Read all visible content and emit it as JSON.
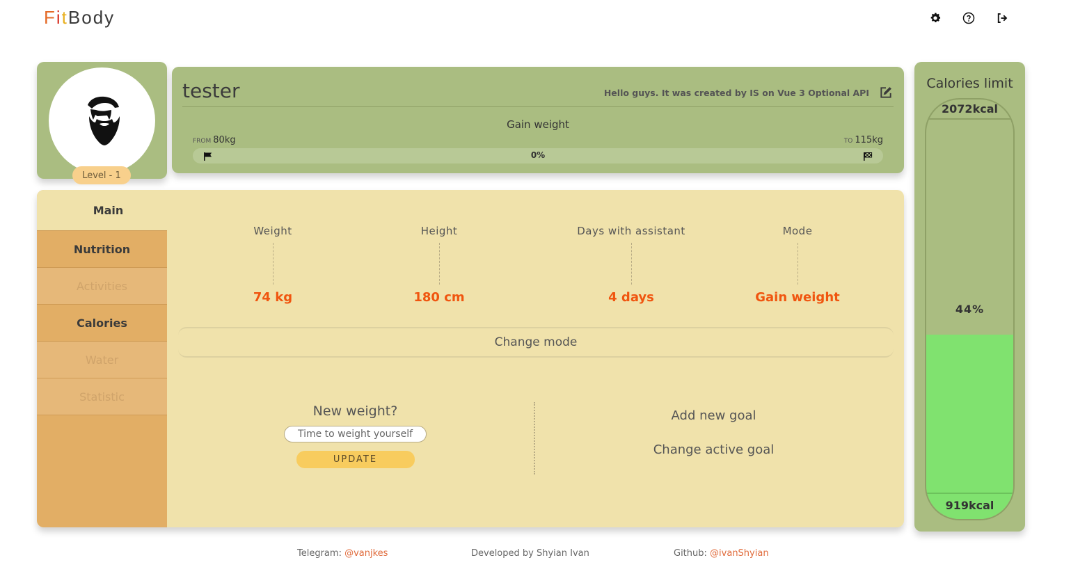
{
  "header": {
    "logo": {
      "part1": "F",
      "part2": "i",
      "part3": "t",
      "part4": "Body"
    },
    "icons": [
      "gear-icon",
      "help-icon",
      "logout-icon"
    ]
  },
  "avatar": {
    "level_label": "Level - 1"
  },
  "profile": {
    "username": "tester",
    "bio": "Hello guys. It was created by IS on Vue 3 Optional API",
    "goal_name": "Gain weight",
    "from_label": "FROM",
    "from_value": "80kg",
    "to_label": "TO",
    "to_value": "115kg",
    "progress_text": "0%",
    "progress_fraction": 0
  },
  "sidebar": {
    "items": [
      {
        "label": "Main",
        "state": "active"
      },
      {
        "label": "Nutrition",
        "state": "enabled"
      },
      {
        "label": "Activities",
        "state": "disabled"
      },
      {
        "label": "Calories",
        "state": "enabled"
      },
      {
        "label": "Water",
        "state": "disabled"
      },
      {
        "label": "Statistic",
        "state": "disabled"
      }
    ]
  },
  "stats": [
    {
      "label": "Weight",
      "value": "74 kg"
    },
    {
      "label": "Height",
      "value": "180 cm"
    },
    {
      "label": "Days with assistant",
      "value": "4 days"
    },
    {
      "label": "Mode",
      "value": "Gain weight"
    }
  ],
  "change_mode_label": "Change mode",
  "new_weight": {
    "title": "New weight?",
    "placeholder": "Time to weight yourself",
    "button_label": "UPDATE"
  },
  "goals": {
    "add_label": "Add new goal",
    "change_label": "Change active goal"
  },
  "calories": {
    "title": "Calories limit",
    "limit": "2072kcal",
    "percent": "44%",
    "consumed": "919kcal",
    "fill_fraction": 0.44
  },
  "footer": {
    "telegram_label": "Telegram:",
    "telegram_handle": "@vanjkes",
    "developer": "Developed by Shyian Ivan",
    "github_label": "Github:",
    "github_handle": "@ivanShyian"
  },
  "colors": {
    "card_green": "#aabd81",
    "panel_yellow": "#f0e2ab",
    "sidebar_orange": "#e2ae65",
    "accent_orange": "#f0550f",
    "fill_green": "#80e26f"
  }
}
